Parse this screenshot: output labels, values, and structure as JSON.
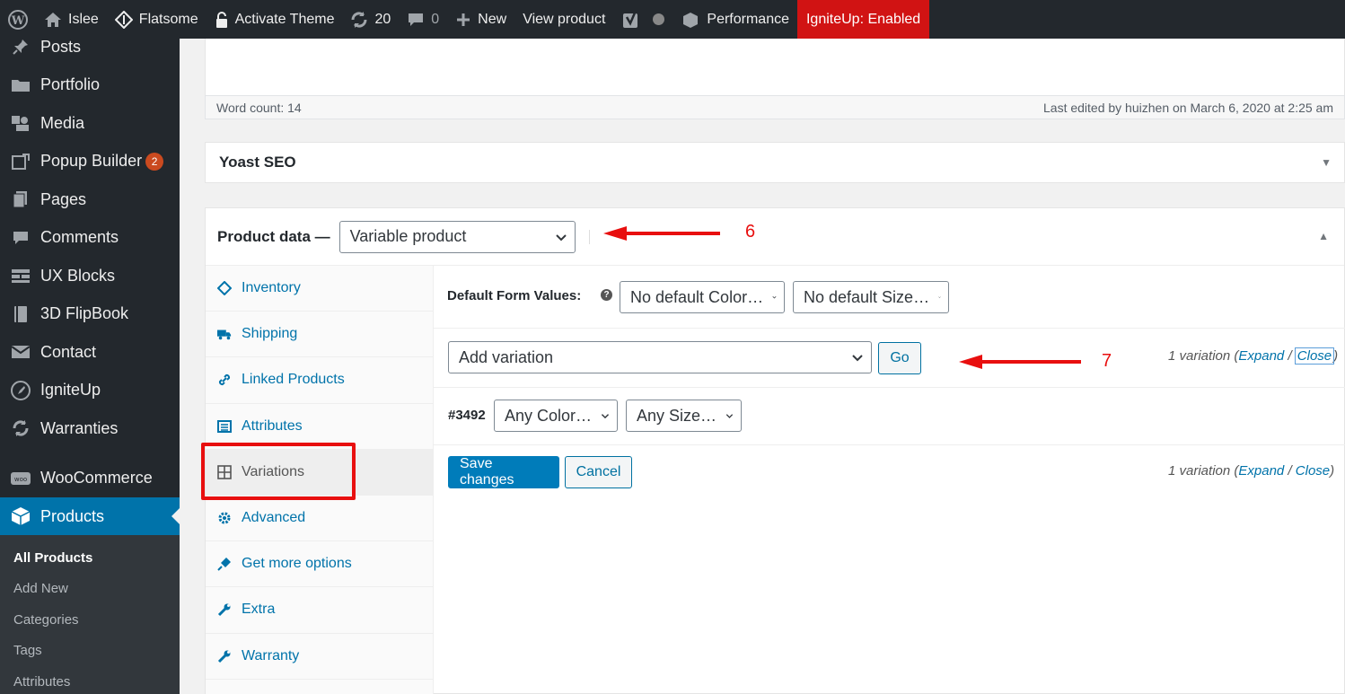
{
  "adminbar": {
    "site_name": "Islee",
    "flatsome": "Flatsome",
    "activate_theme": "Activate Theme",
    "updates_count": "20",
    "comments_count": "0",
    "new_label": "New",
    "view_product": "View product",
    "performance": "Performance",
    "igniteup": "IgniteUp: Enabled"
  },
  "sidebar": {
    "items": [
      {
        "label": "Posts",
        "icon": "pin-icon"
      },
      {
        "label": "Portfolio",
        "icon": "folder-icon"
      },
      {
        "label": "Media",
        "icon": "media-icon"
      },
      {
        "label": "Popup Builder",
        "icon": "popup-icon",
        "badge": "2"
      },
      {
        "label": "Pages",
        "icon": "pages-icon"
      },
      {
        "label": "Comments",
        "icon": "comment-icon"
      },
      {
        "label": "UX Blocks",
        "icon": "blocks-icon"
      },
      {
        "label": "3D FlipBook",
        "icon": "book-icon"
      },
      {
        "label": "Contact",
        "icon": "mail-icon"
      },
      {
        "label": "IgniteUp",
        "icon": "rocket-icon"
      },
      {
        "label": "Warranties",
        "icon": "refresh-icon"
      },
      {
        "label": "WooCommerce",
        "icon": "woo-icon"
      },
      {
        "label": "Products",
        "icon": "box-icon"
      }
    ],
    "submenu": [
      "All Products",
      "Add New",
      "Categories",
      "Tags",
      "Attributes"
    ]
  },
  "editor": {
    "word_count": "Word count: 14",
    "last_edited": "Last edited by huizhen on March 6, 2020 at 2:25 am"
  },
  "yoast": {
    "title": "Yoast SEO"
  },
  "product_data": {
    "title": "Product data —",
    "type_selected": "Variable product",
    "tabs": [
      {
        "label": "Inventory",
        "icon": "tag-icon"
      },
      {
        "label": "Shipping",
        "icon": "truck-icon"
      },
      {
        "label": "Linked Products",
        "icon": "link-icon"
      },
      {
        "label": "Attributes",
        "icon": "list-icon"
      },
      {
        "label": "Variations",
        "icon": "grid-icon"
      },
      {
        "label": "Advanced",
        "icon": "gear-icon"
      },
      {
        "label": "Get more options",
        "icon": "plugin-icon"
      },
      {
        "label": "Extra",
        "icon": "wrench-icon"
      },
      {
        "label": "Warranty",
        "icon": "wrench-icon"
      }
    ],
    "default_form_label": "Default Form Values:",
    "default_color": "No default Color…",
    "default_size": "No default Size…",
    "add_variation": "Add variation",
    "go": "Go",
    "variation_count": "1 variation",
    "expand": "Expand",
    "slash": "/",
    "close": "Close",
    "variation_id": "#3492",
    "any_color": "Any Color…",
    "any_size": "Any Size…",
    "save_changes": "Save changes",
    "cancel": "Cancel"
  },
  "annotations": {
    "six": "6",
    "seven": "7"
  },
  "colors": {
    "admin_bar": "#23282d",
    "accent": "#0073aa",
    "ignite_red": "#d11313",
    "annotation_red": "#e80f0f"
  }
}
